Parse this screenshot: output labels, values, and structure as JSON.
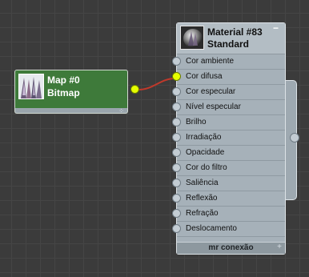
{
  "map_node": {
    "title": "Map #0",
    "subtitle": "Bitmap",
    "color": "#3e7a3a"
  },
  "material_node": {
    "title": "Material #83",
    "subtitle": "Standard",
    "slots": [
      {
        "label": "Cor ambiente",
        "connected": false
      },
      {
        "label": "Cor difusa",
        "connected": true
      },
      {
        "label": "Cor especular",
        "connected": false
      },
      {
        "label": "Nível especular",
        "connected": false
      },
      {
        "label": "Brilho",
        "connected": false
      },
      {
        "label": "Irradiação",
        "connected": false
      },
      {
        "label": "Opacidade",
        "connected": false
      },
      {
        "label": "Cor do filtro",
        "connected": false
      },
      {
        "label": "Saliência",
        "connected": false
      },
      {
        "label": "Reflexão",
        "connected": false
      },
      {
        "label": "Refração",
        "connected": false
      },
      {
        "label": "Deslocamento",
        "connected": false
      }
    ],
    "footer_label": "mr conexão",
    "footer_icon": "plus-icon",
    "collapse_icon": "minus-icon"
  },
  "wire": {
    "color": "#c0392b",
    "from": "Map #0",
    "to": "Cor difusa"
  }
}
